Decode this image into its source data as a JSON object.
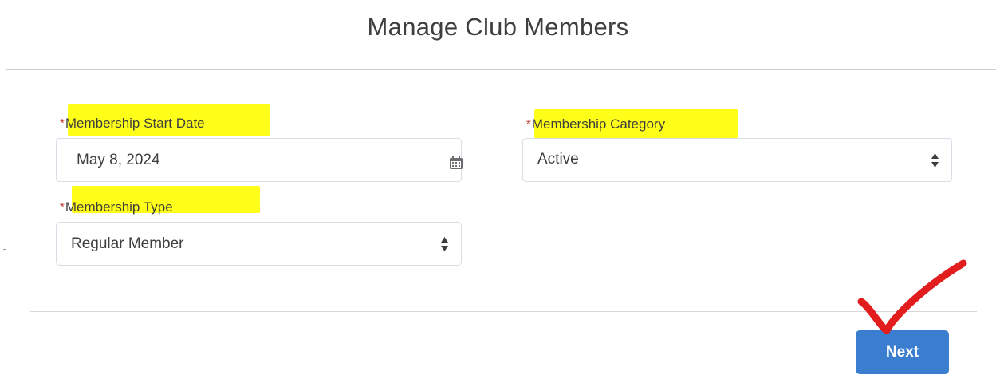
{
  "page": {
    "title": "Manage Club Members"
  },
  "form": {
    "required_mark": "*",
    "start_date": {
      "label": "Membership Start Date",
      "value": "May 8, 2024",
      "icon": "calendar-icon"
    },
    "category": {
      "label": "Membership Category",
      "value": "Active",
      "icon": "up-down-arrows-icon"
    },
    "type": {
      "label": "Membership Type",
      "value": "Regular Member",
      "icon": "up-down-arrows-icon"
    }
  },
  "footer": {
    "next_label": "Next"
  },
  "annotations": {
    "highlight_color": "#ffff00",
    "checkmark_color": "#e11d1d"
  }
}
